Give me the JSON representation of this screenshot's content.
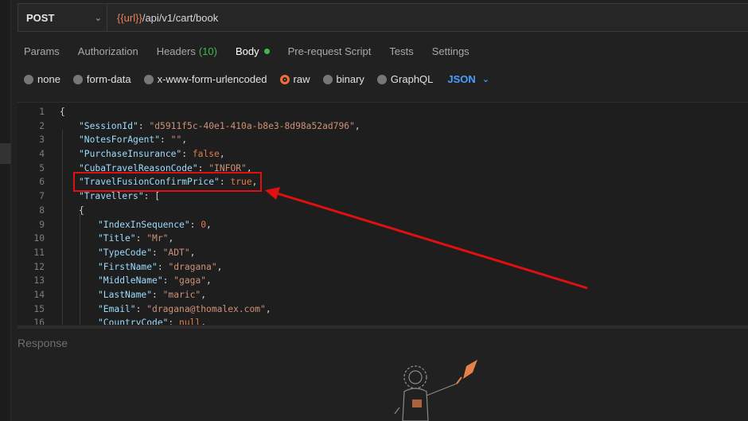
{
  "request": {
    "method": "POST",
    "url_variable": "{{url}}",
    "url_path": "/api/v1/cart/book"
  },
  "tabs": [
    {
      "label": "Params"
    },
    {
      "label": "Authorization"
    },
    {
      "label": "Headers",
      "count": "(10)"
    },
    {
      "label": "Body"
    },
    {
      "label": "Pre-request Script"
    },
    {
      "label": "Tests"
    },
    {
      "label": "Settings"
    }
  ],
  "body_types": [
    {
      "label": "none",
      "selected": false
    },
    {
      "label": "form-data",
      "selected": false
    },
    {
      "label": "x-www-form-urlencoded",
      "selected": false
    },
    {
      "label": "raw",
      "selected": true
    },
    {
      "label": "binary",
      "selected": false
    },
    {
      "label": "GraphQL",
      "selected": false
    }
  ],
  "format": "JSON",
  "editor": {
    "lines": [
      {
        "n": "1",
        "text": "{"
      },
      {
        "n": "2",
        "key": "\"SessionId\"",
        "value": "\"d5911f5c-40e1-410a-b8e3-8d98a52ad796\"",
        "value_type": "string",
        "tail": ","
      },
      {
        "n": "3",
        "key": "\"NotesForAgent\"",
        "value": "\"\"",
        "value_type": "string",
        "tail": ","
      },
      {
        "n": "4",
        "key": "\"PurchaseInsurance\"",
        "value": "false",
        "value_type": "literal",
        "tail": ","
      },
      {
        "n": "5",
        "key": "\"CubaTravelReasonCode\"",
        "value": "\"INFOR\"",
        "value_type": "string",
        "tail": ","
      },
      {
        "n": "6",
        "key": "\"TravelFusionConfirmPrice\"",
        "value": "true",
        "value_type": "literal",
        "tail": ","
      },
      {
        "n": "7",
        "key": "\"Travellers\"",
        "value": "[",
        "value_type": "punct",
        "tail": ""
      },
      {
        "n": "8",
        "text": "{"
      },
      {
        "n": "9",
        "key": "\"IndexInSequence\"",
        "value": "0",
        "value_type": "literal",
        "tail": ","
      },
      {
        "n": "10",
        "key": "\"Title\"",
        "value": "\"Mr\"",
        "value_type": "string",
        "tail": ","
      },
      {
        "n": "11",
        "key": "\"TypeCode\"",
        "value": "\"ADT\"",
        "value_type": "string",
        "tail": ","
      },
      {
        "n": "12",
        "key": "\"FirstName\"",
        "value": "\"dragana\"",
        "value_type": "string",
        "tail": ","
      },
      {
        "n": "13",
        "key": "\"MiddleName\"",
        "value": "\"gaga\"",
        "value_type": "string",
        "tail": ","
      },
      {
        "n": "14",
        "key": "\"LastName\"",
        "value": "\"maric\"",
        "value_type": "string",
        "tail": ","
      },
      {
        "n": "15",
        "key": "\"Email\"",
        "value": "\"dragana@thomalex.com\"",
        "value_type": "string",
        "tail": ","
      },
      {
        "n": "16",
        "key": "\"CountryCode\"",
        "value": "null",
        "value_type": "literal",
        "tail": ","
      }
    ]
  },
  "response": {
    "label": "Response"
  },
  "colors": {
    "accent_green": "#3fb950",
    "accent_orange": "#f26b3a",
    "json_blue": "#4a9eff",
    "annotation_red": "#e01010"
  }
}
